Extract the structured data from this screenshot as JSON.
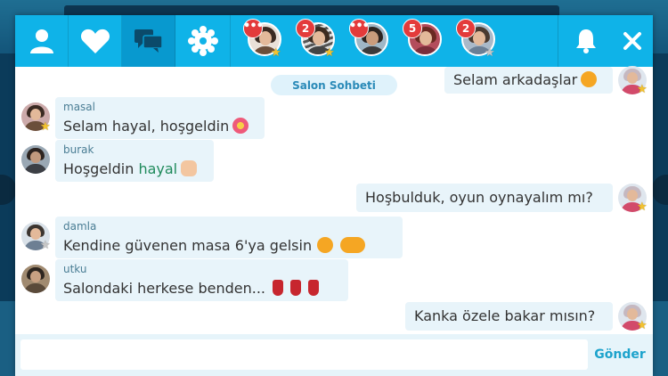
{
  "colors": {
    "header": "#0fb3e8",
    "header_active": "#0899cf",
    "bubble": "#e8f4fa",
    "badge": "#e33b3b",
    "send": "#1da3cc"
  },
  "header": {
    "buttons": [
      {
        "icon": "user-icon"
      },
      {
        "icon": "heart-icon"
      },
      {
        "icon": "chat-icon",
        "active": true
      },
      {
        "icon": "settings-icon"
      }
    ],
    "conversations": [
      {
        "badge": "•••"
      },
      {
        "badge": "2"
      },
      {
        "badge": "•••"
      },
      {
        "badge": "5"
      },
      {
        "badge": "2"
      }
    ],
    "notification_icon": "bell-icon",
    "close_icon": "close-icon"
  },
  "room_label": "Salon Sohbeti",
  "messages": [
    {
      "side": "out",
      "text": "Selam arkadaşlar",
      "emoji": "smile"
    },
    {
      "side": "in",
      "user": "masal",
      "text": "Selam hayal, hoşgeldin",
      "emoji": "flower"
    },
    {
      "side": "in",
      "user": "burak",
      "text_before": "Hoşgeldin ",
      "mention": "hayal",
      "emoji": "wave"
    },
    {
      "side": "out",
      "text": "Hoşbulduk, oyun oynayalım mı?"
    },
    {
      "side": "in",
      "user": "damla",
      "text": "Kendine güvenen masa 6'ya gelsin",
      "emoji": "sunglasses"
    },
    {
      "side": "in",
      "user": "utku",
      "text": "Salondaki herkese benden...",
      "emoji": "tea"
    },
    {
      "side": "out",
      "text": "Kanka özele bakar mısın?"
    }
  ],
  "composer": {
    "placeholder": "",
    "send_label": "Gönder"
  }
}
